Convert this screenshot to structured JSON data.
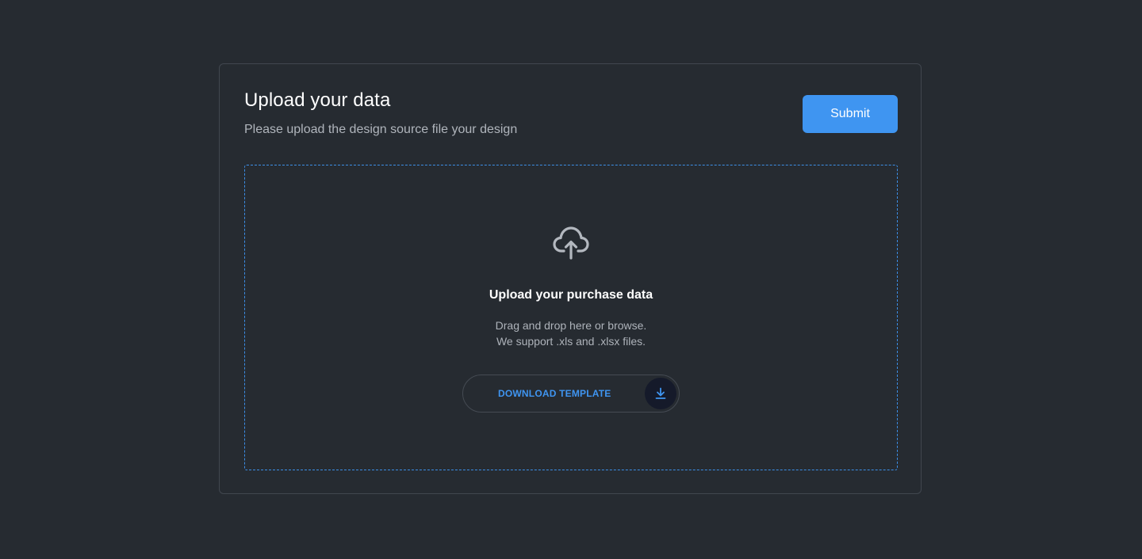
{
  "header": {
    "title": "Upload your data",
    "subtitle": "Please upload the design source file your design",
    "submit_label": "Submit"
  },
  "dropzone": {
    "icon": "cloud-upload-icon",
    "title": "Upload your purchase data",
    "description_line1": "Drag and drop here or browse.",
    "description_line2": "We support .xls and .xlsx files.",
    "download_label": "DOWNLOAD TEMPLATE",
    "download_icon": "download-icon"
  },
  "colors": {
    "background": "#262b31",
    "accent": "#3f95f1",
    "dashed_border": "#3c8ee6",
    "card_border": "#41474f",
    "icon_circle": "#151a2a"
  }
}
